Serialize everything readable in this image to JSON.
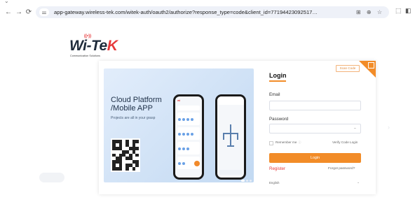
{
  "browser": {
    "url": "app-gateway.wireless-tek.com/witek-auth/oauth2/authorize?response_type=code&client_id=771944230925173993&redirec...",
    "back_icon": "arrow-left-icon",
    "forward_icon": "arrow-right-icon",
    "reload_icon": "reload-icon",
    "site_info_icon": "tune-icon",
    "actions": [
      "translate-icon",
      "zoom-icon",
      "star-icon",
      "extensions-icon",
      "sidebar-icon"
    ]
  },
  "brand": {
    "logo_text_dark": "Wi-Te",
    "logo_text_red": "K",
    "logo_wifi": "((•))",
    "tagline": "Communication Solutions"
  },
  "promo": {
    "title_line1": "Cloud Platform",
    "title_line2": "/Mobile APP",
    "subtitle": "Projects are all in your grasp"
  },
  "login": {
    "scan_code_label": "Scan Code",
    "title": "Login",
    "email_label": "Email",
    "email_value": "",
    "password_label": "Password",
    "password_value": "",
    "remember_me_label": "Remember me",
    "remember_me_checked": false,
    "verify_code_link": "Verify Code Login",
    "login_button": "Login",
    "register_link": "Register",
    "forgot_password_link": "Forgot password?",
    "language_value": "English"
  },
  "colors": {
    "accent": "#f28c28",
    "brand_red": "#e6393a",
    "panel_bg": "#d3e3f7"
  }
}
